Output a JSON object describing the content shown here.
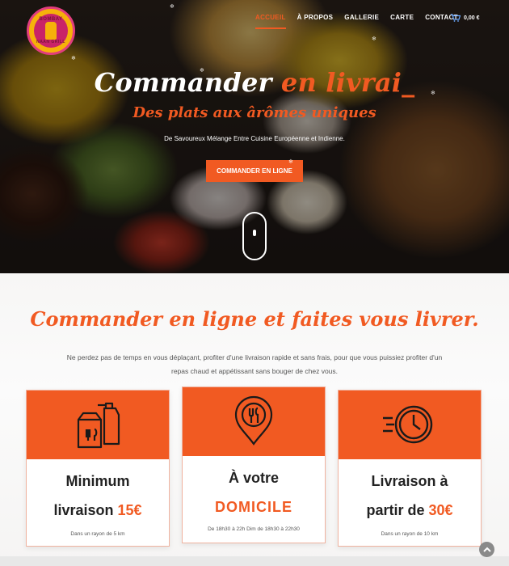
{
  "header": {
    "logo_top_text": "BOMBAY",
    "logo_bottom_text": "NAAN GRILL",
    "nav": [
      {
        "label": "ACCUEIL",
        "active": true
      },
      {
        "label": "À PROPOS",
        "active": false
      },
      {
        "label": "GALLERIE",
        "active": false
      },
      {
        "label": "CARTE",
        "active": false
      },
      {
        "label": "CONTACT",
        "active": false
      }
    ],
    "cart_price": "0,00 €",
    "cart_icon": "shopping-cart-icon"
  },
  "hero": {
    "title_main": "Commander ",
    "title_accent": "en livrai_",
    "subtitle": "Des plats aux ârômes uniques",
    "description": "De Savoureux Mélange Entre Cuisine Européenne et Indienne.",
    "button_label": "COMMANDER EN LIGNE"
  },
  "section": {
    "title": "Commander en ligne et faites vous livrer.",
    "description": "Ne perdez pas de temps en vous déplaçant, profiter d'une livraison rapide et sans frais, pour que vous puissiez profiter d'un repas chaud et appétissant sans bouger de chez vous."
  },
  "cards": [
    {
      "icon": "delivery-bag-icon",
      "line1": "Minimum",
      "line2_text": "livraison ",
      "line2_highlight": "15€",
      "note": "Dans un rayon de 5 km"
    },
    {
      "icon": "location-pin-cutlery-icon",
      "line1": "À votre",
      "highlight": "DOMICILE",
      "note": "De 18h30 à 22h Dim de 18h30 à 22h30"
    },
    {
      "icon": "fast-clock-icon",
      "line1": "Livraison à",
      "line2_text": "partir de ",
      "line2_highlight": "30€",
      "note": "Dans un rayon de 10 km"
    }
  ],
  "colors": {
    "accent": "#f15a22",
    "logo_pink": "#e13d7d",
    "logo_yellow": "#f6b10a"
  }
}
